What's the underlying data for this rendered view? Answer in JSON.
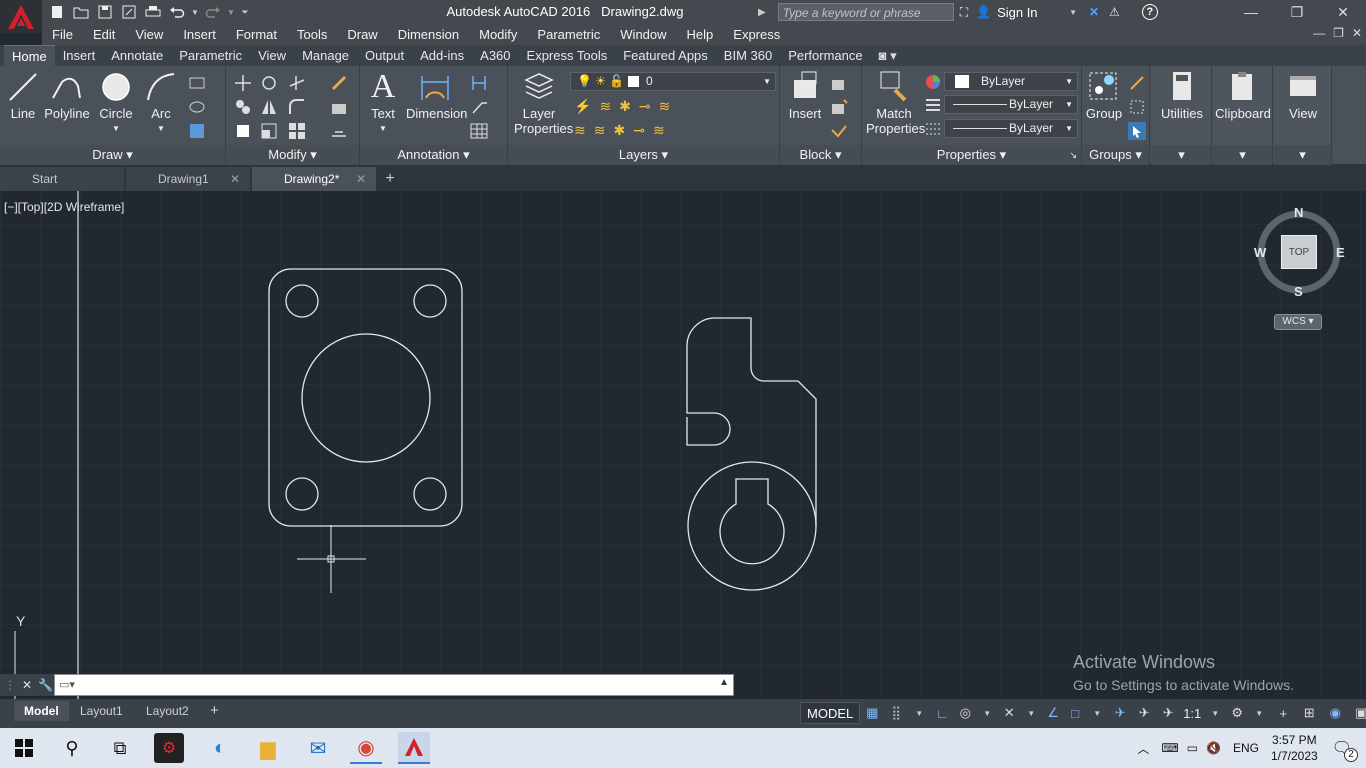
{
  "app": {
    "title": "Autodesk AutoCAD 2016",
    "filename": "Drawing2.dwg",
    "logo_letter": "A",
    "search_placeholder": "Type a keyword or phrase",
    "sign_in": "Sign In"
  },
  "menu": [
    "File",
    "Edit",
    "View",
    "Insert",
    "Format",
    "Tools",
    "Draw",
    "Dimension",
    "Modify",
    "Parametric",
    "Window",
    "Help",
    "Express"
  ],
  "ribbon_tabs": [
    "Home",
    "Insert",
    "Annotate",
    "Parametric",
    "View",
    "Manage",
    "Output",
    "Add-ins",
    "A360",
    "Express Tools",
    "Featured Apps",
    "BIM 360",
    "Performance"
  ],
  "ribbon": {
    "draw": {
      "title": "Draw",
      "line": "Line",
      "polyline": "Polyline",
      "circle": "Circle",
      "arc": "Arc"
    },
    "modify": {
      "title": "Modify"
    },
    "annotation": {
      "title": "Annotation",
      "text": "Text",
      "dimension": "Dimension"
    },
    "layers": {
      "title": "Layers",
      "layer_properties_1": "Layer",
      "layer_properties_2": "Properties",
      "current_layer": "0"
    },
    "block": {
      "title": "Block",
      "insert": "Insert"
    },
    "properties": {
      "title": "Properties",
      "match_1": "Match",
      "match_2": "Properties",
      "color": "ByLayer",
      "linetype": "ByLayer",
      "lineweight": "ByLayer"
    },
    "groups": {
      "title": "Groups",
      "group": "Group"
    },
    "utilities": {
      "title": "Utilities"
    },
    "clipboard": {
      "title": "Clipboard"
    },
    "view": {
      "title": "View"
    }
  },
  "file_tabs": [
    {
      "label": "Start"
    },
    {
      "label": "Drawing1"
    },
    {
      "label": "Drawing2*"
    }
  ],
  "viewport": {
    "label": "[−][Top][2D Wireframe]",
    "compass": {
      "n": "N",
      "s": "S",
      "e": "E",
      "w": "W",
      "top": "TOP",
      "wcs": "WCS"
    },
    "ucs_y": "Y"
  },
  "layout_tabs": [
    "Model",
    "Layout1",
    "Layout2"
  ],
  "status": {
    "model": "MODEL",
    "scale": "1:1"
  },
  "watermark": {
    "line1": "Activate Windows",
    "line2": "Go to Settings to activate Windows."
  },
  "taskbar": {
    "lang": "ENG",
    "time": "3:57 PM",
    "date": "1/7/2023",
    "notif": "2"
  }
}
